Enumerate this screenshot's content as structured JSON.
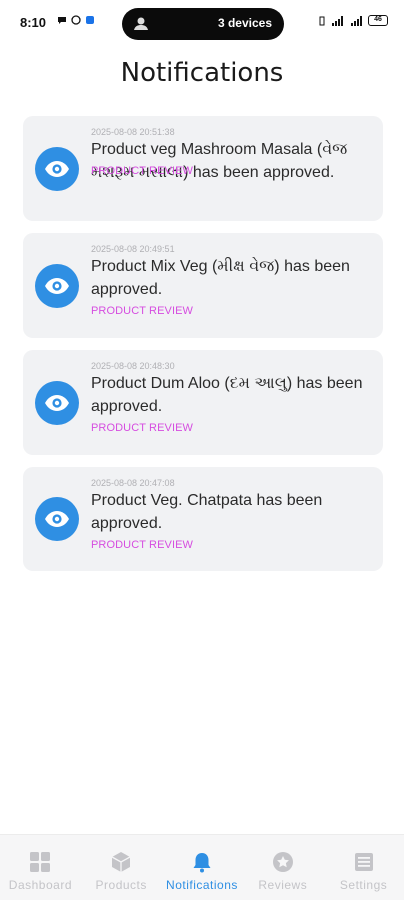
{
  "status_bar": {
    "time": "8:10",
    "devices_text": "3 devices",
    "battery": "46"
  },
  "header": {
    "title": "Notifications"
  },
  "notifications": [
    {
      "timestamp": "2025-08-08 20:51:38",
      "message": "Product veg Mashroom Masala (વેજ મશરૂમ મસાલા) has been approved.",
      "tag": "PRODUCT REVIEW",
      "icon": "eye-icon"
    },
    {
      "timestamp": "2025-08-08 20:49:51",
      "message": "Product Mix Veg (મીક્ષ વેજ) has been approved.",
      "tag": "PRODUCT REVIEW",
      "icon": "eye-icon"
    },
    {
      "timestamp": "2025-08-08 20:48:30",
      "message": "Product Dum Aloo (દમ આલુ) has been approved.",
      "tag": "PRODUCT REVIEW",
      "icon": "eye-icon"
    },
    {
      "timestamp": "2025-08-08 20:47:08",
      "message": "Product Veg. Chatpata has been approved.",
      "tag": "PRODUCT REVIEW",
      "icon": "eye-icon"
    }
  ],
  "bottom_nav": {
    "items": [
      {
        "label": "Dashboard",
        "icon": "grid-icon"
      },
      {
        "label": "Products",
        "icon": "box-icon"
      },
      {
        "label": "Notifications",
        "icon": "bell-icon",
        "active": true
      },
      {
        "label": "Reviews",
        "icon": "star-icon"
      },
      {
        "label": "Settings",
        "icon": "list-icon"
      }
    ]
  },
  "colors": {
    "accent": "#2f8fe3",
    "tag": "#d64de0",
    "card_bg": "#f1f2f4",
    "inactive": "#c4c4c8"
  }
}
